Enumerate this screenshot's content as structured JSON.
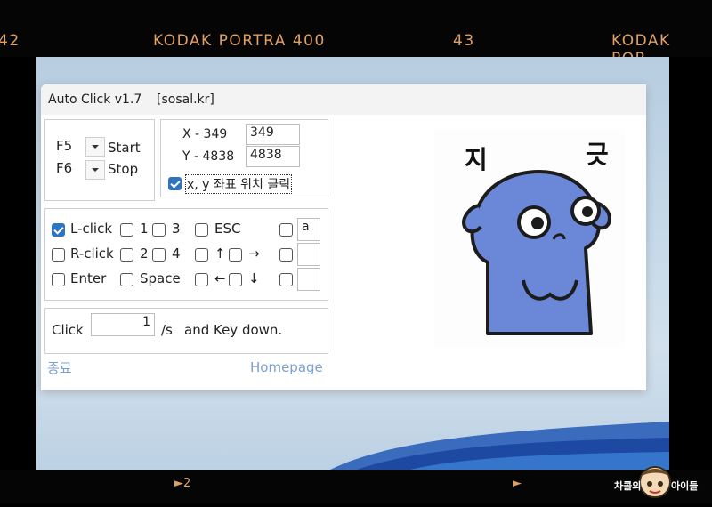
{
  "film": {
    "frame_left": "42",
    "label_left": "KODAK PORTRA 400",
    "frame_mid": "43",
    "label_right": "KODAK POR",
    "arrow_left": "►2",
    "arrow_right": "►"
  },
  "app": {
    "title": "Auto Click v1.7",
    "site": "[sosal.kr]",
    "hotkeys": {
      "start_key": "F5",
      "start_label": "Start",
      "stop_key": "F6",
      "stop_label": "Stop"
    },
    "coords": {
      "x_label": "X - 349",
      "y_label": "Y - 4838",
      "x_value": "349",
      "y_value": "4838",
      "checkbox_label": "x, y 좌표 위치 클릭",
      "checked": true
    },
    "options": {
      "lclick": "L-click",
      "rclick": "R-click",
      "enter": "Enter",
      "one": "1",
      "two": "2",
      "three": "3",
      "four": "4",
      "space": "Space",
      "esc": "ESC",
      "up": "↑",
      "right": "→",
      "left": "←",
      "down": "↓",
      "key_a": "a",
      "lclick_checked": true
    },
    "rate": {
      "label": "Click",
      "value": "1",
      "unit": "/s",
      "suffix": "and Key down."
    },
    "footer": {
      "exit": "종료",
      "homepage": "Homepage"
    },
    "sticker": {
      "text_left": "지",
      "text_right": "긋"
    }
  },
  "watermark": {
    "text": "차콜의 아이들"
  },
  "colors": {
    "accent": "#2f74c0",
    "film_text": "#e0a063",
    "character": "#6b87d8"
  }
}
